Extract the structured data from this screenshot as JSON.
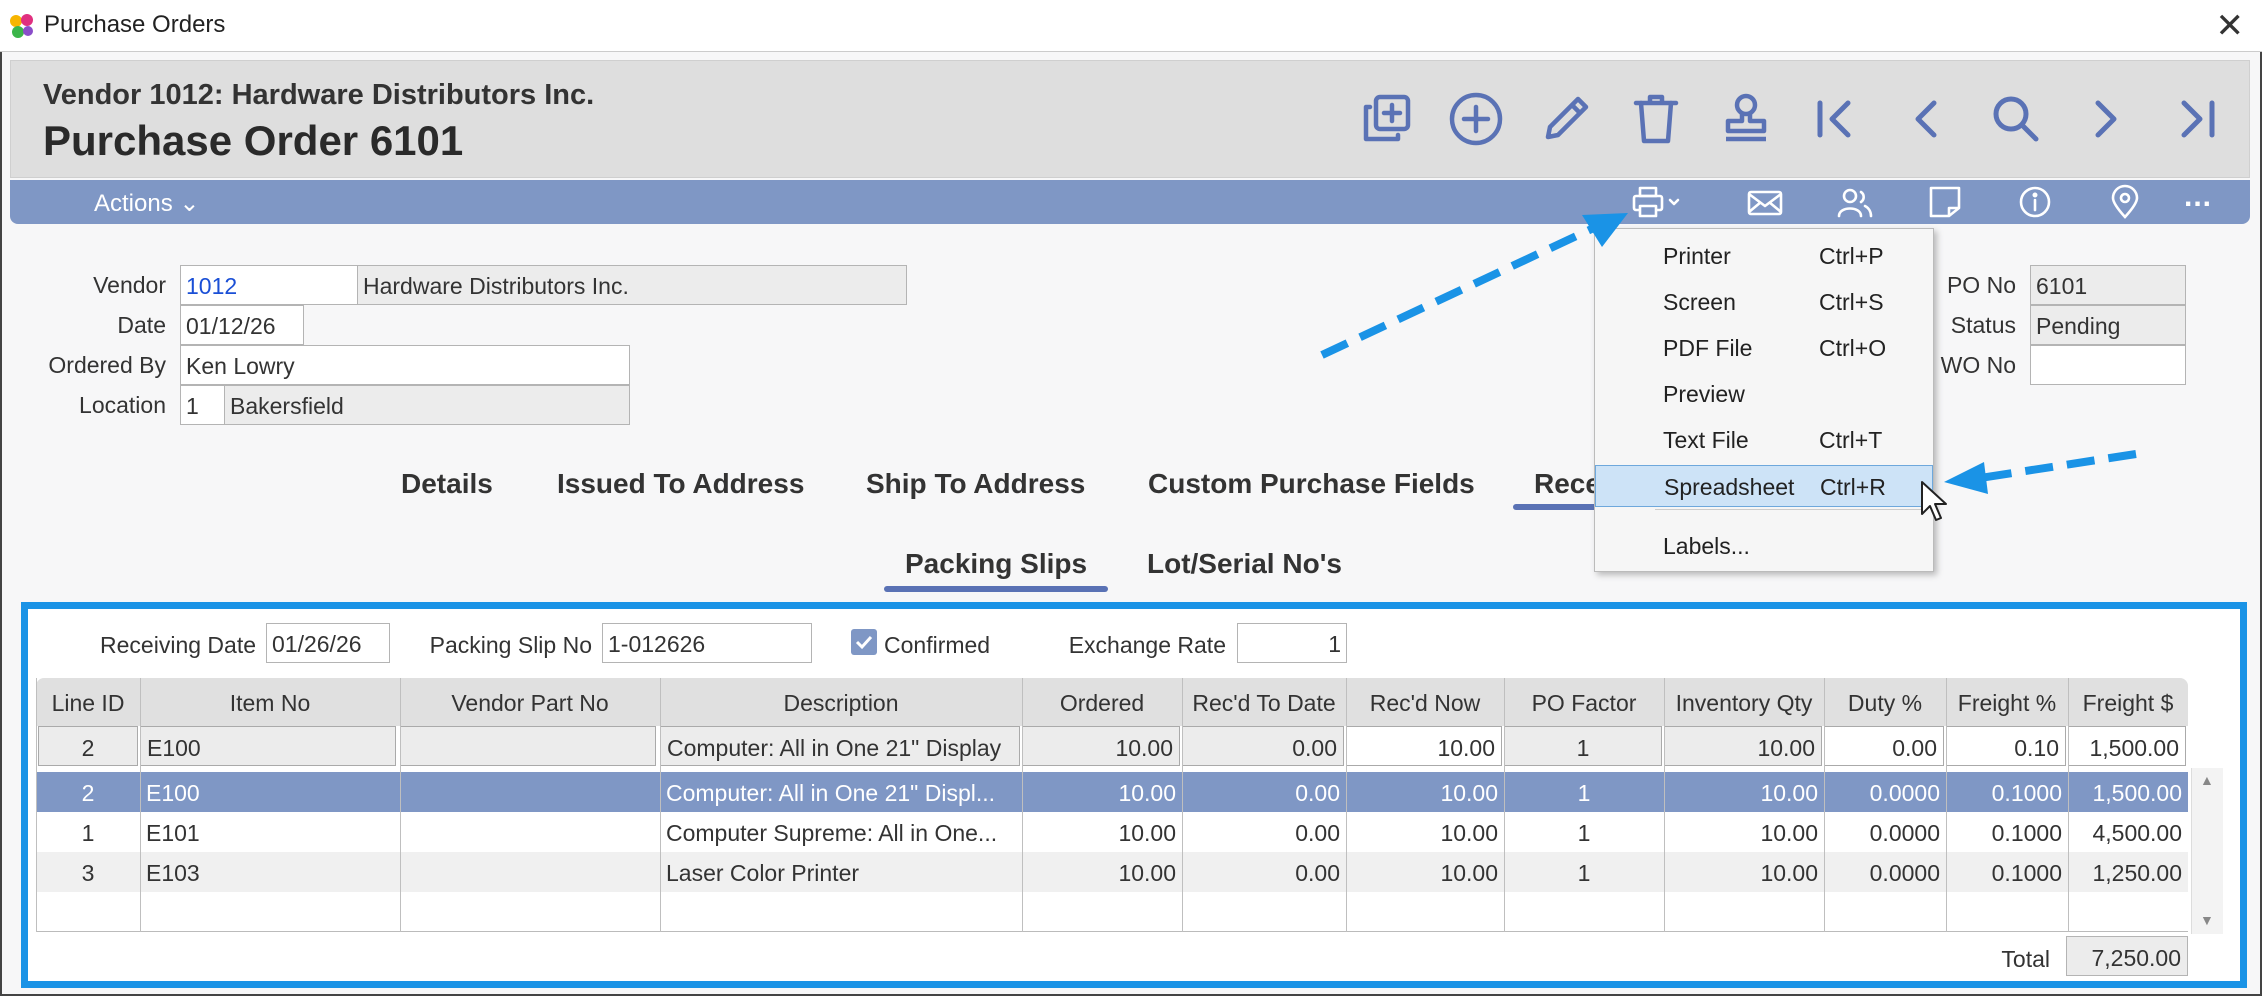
{
  "window": {
    "title": "Purchase Orders"
  },
  "header": {
    "vendor_line": "Vendor 1012: Hardware Distributors Inc.",
    "po_title": "Purchase Order 6101"
  },
  "toolbar_icons": [
    "copy-icon",
    "add-icon",
    "edit-icon",
    "delete-icon",
    "stamp-icon",
    "first-record-icon",
    "previous-record-icon",
    "search-icon",
    "next-record-icon",
    "last-record-icon"
  ],
  "actionbar": {
    "actions_label": "Actions",
    "icons": [
      "print-icon",
      "email-icon",
      "contacts-icon",
      "note-icon",
      "info-icon",
      "location-icon"
    ],
    "more": "..."
  },
  "form": {
    "vendor_label": "Vendor",
    "vendor_code": "1012",
    "vendor_name": "Hardware Distributors Inc.",
    "date_label": "Date",
    "date_value": "01/12/26",
    "ordered_by_label": "Ordered By",
    "ordered_by_value": "Ken Lowry",
    "location_label": "Location",
    "location_code": "1",
    "location_name": "Bakersfield",
    "po_no_label": "PO No",
    "po_no_value": "6101",
    "status_label": "Status",
    "status_value": "Pending",
    "wo_no_label": "WO No",
    "wo_no_value": ""
  },
  "tabs": [
    "Details",
    "Issued To Address",
    "Ship To Address",
    "Custom Purchase Fields",
    "Rece"
  ],
  "subtabs": [
    "Packing Slips",
    "Lot/Serial No's"
  ],
  "receiving": {
    "receiving_date_label": "Receiving Date",
    "receiving_date_value": "01/26/26",
    "packing_slip_label": "Packing Slip No",
    "packing_slip_value": "1-012626",
    "confirmed_label": "Confirmed",
    "exchange_rate_label": "Exchange Rate",
    "exchange_rate_value": "1"
  },
  "grid": {
    "columns": [
      "Line ID",
      "Item No",
      "Vendor Part No",
      "Description",
      "Ordered",
      "Rec'd To Date",
      "Rec'd Now",
      "PO Factor",
      "Inventory Qty",
      "Duty %",
      "Freight %",
      "Freight $"
    ],
    "edit_row": [
      "2",
      "E100",
      "",
      "Computer: All in One 21\" Display",
      "10.00",
      "0.00",
      "10.00",
      "1",
      "10.00",
      "0.00",
      "0.10",
      "1,500.00"
    ],
    "rows": [
      [
        "2",
        "E100",
        "",
        "Computer: All in One 21\" Displ...",
        "10.00",
        "0.00",
        "10.00",
        "1",
        "10.00",
        "0.0000",
        "0.1000",
        "1,500.00"
      ],
      [
        "1",
        "E101",
        "",
        "Computer Supreme: All in One...",
        "10.00",
        "0.00",
        "10.00",
        "1",
        "10.00",
        "0.0000",
        "0.1000",
        "4,500.00"
      ],
      [
        "3",
        "E103",
        "",
        "Laser Color Printer",
        "10.00",
        "0.00",
        "10.00",
        "1",
        "10.00",
        "0.0000",
        "0.1000",
        "1,250.00"
      ]
    ],
    "total_label": "Total",
    "total_value": "7,250.00"
  },
  "print_menu": {
    "items": [
      {
        "label": "Printer",
        "shortcut": "Ctrl+P"
      },
      {
        "label": "Screen",
        "shortcut": "Ctrl+S"
      },
      {
        "label": "PDF File",
        "shortcut": "Ctrl+O"
      },
      {
        "label": "Preview",
        "shortcut": ""
      },
      {
        "label": "Text File",
        "shortcut": "Ctrl+T"
      },
      {
        "label": "Spreadsheet",
        "shortcut": "Ctrl+R"
      }
    ],
    "labels_item": "Labels...",
    "highlighted_index": 5
  },
  "colors": {
    "accent_bar": "#7f97c5",
    "highlight_frame": "#1a93e6",
    "link": "#1a4fd6",
    "icon": "#5a72b5"
  }
}
